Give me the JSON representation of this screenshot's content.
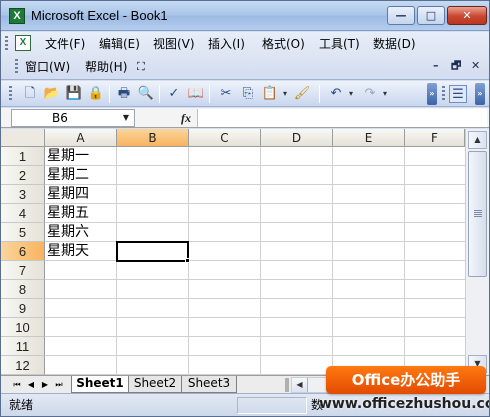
{
  "window": {
    "title": "Microsoft Excel - Book1",
    "app_icon": "X",
    "buttons": {
      "minimize": "—",
      "maximize": "□",
      "close": "✕"
    }
  },
  "menu": {
    "row1": [
      "文件(F)",
      "编辑(E)",
      "视图(V)",
      "插入(I)",
      "格式(O)",
      "工具(T)",
      "数据(D)"
    ],
    "row2": [
      "窗口(W)",
      "帮助(H)"
    ],
    "mdi": {
      "minimize": "–",
      "restore": "🗗",
      "close": "✕"
    }
  },
  "toolbar": {
    "icons": [
      "new-icon",
      "open-icon",
      "save-icon",
      "permission-icon",
      "print-icon",
      "print-preview-icon",
      "spelling-icon",
      "research-icon",
      "cut-icon",
      "copy-icon",
      "paste-icon",
      "format-painter-icon",
      "undo-icon",
      "redo-icon",
      "align-left-icon"
    ]
  },
  "formula_bar": {
    "name_box": "B6",
    "fx_label": "fx",
    "formula": ""
  },
  "grid": {
    "columns": [
      "A",
      "B",
      "C",
      "D",
      "E",
      "F"
    ],
    "active_column": "B",
    "rows": [
      "1",
      "2",
      "3",
      "4",
      "5",
      "6",
      "7",
      "8",
      "9",
      "10",
      "11",
      "12"
    ],
    "active_row": "6",
    "cells_A": [
      "星期一",
      "星期二",
      "星期四",
      "星期五",
      "星期六",
      "星期天"
    ]
  },
  "sheets": {
    "tabs": [
      "Sheet1",
      "Sheet2",
      "Sheet3"
    ],
    "active": "Sheet1",
    "nav": [
      "⏮",
      "◀",
      "▶",
      "⏭"
    ]
  },
  "status_bar": {
    "left": "就绪",
    "num_partial": "数"
  },
  "watermark": {
    "badge": "Office办公助手",
    "url": "www.officezhushou.com"
  },
  "colors": {
    "title_gradient": "#a9c4e8",
    "active_header": "#f7b45f",
    "watermark_orange": "#e24b00"
  }
}
